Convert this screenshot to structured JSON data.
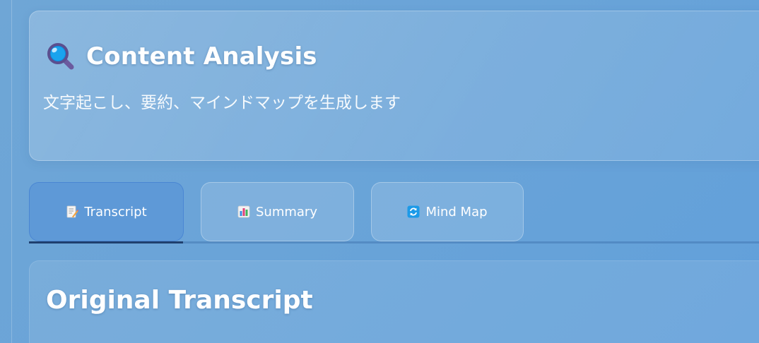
{
  "header": {
    "title": "Content Analysis",
    "subtitle": "文字起こし、要約、マインドマップを生成します",
    "icon": "magnifier-icon"
  },
  "tabs": [
    {
      "label": "Transcript",
      "icon": "memo-icon",
      "active": true
    },
    {
      "label": "Summary",
      "icon": "bar-chart-icon",
      "active": false
    },
    {
      "label": "Mind Map",
      "icon": "refresh-icon",
      "active": false
    }
  ],
  "content": {
    "section_title": "Original Transcript"
  },
  "colors": {
    "background": "#6aa4d8",
    "active_tab": "#5a96d7",
    "active_indicator": "#1f3f6e",
    "text": "#ffffff"
  }
}
